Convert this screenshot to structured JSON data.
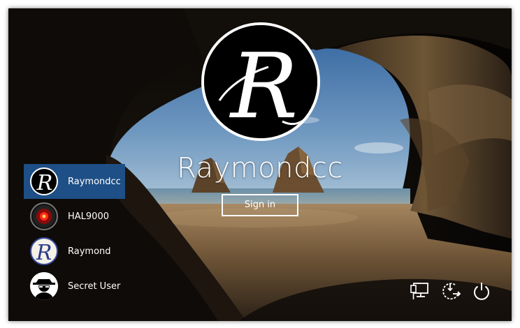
{
  "screen": {
    "selected_user": "Raymondcc",
    "sign_in_label": "Sign in"
  },
  "users": [
    {
      "name": "Raymondcc",
      "avatar": "r-monogram-icon",
      "selected": true
    },
    {
      "name": "HAL9000",
      "avatar": "hal9000-eye-icon",
      "selected": false
    },
    {
      "name": "Raymond",
      "avatar": "r-monogram-icon",
      "selected": false
    },
    {
      "name": "Secret User",
      "avatar": "spy-silhouette-icon",
      "selected": false
    }
  ],
  "system_buttons": [
    {
      "icon": "network-icon"
    },
    {
      "icon": "ease-of-access-icon"
    },
    {
      "icon": "power-icon"
    }
  ]
}
